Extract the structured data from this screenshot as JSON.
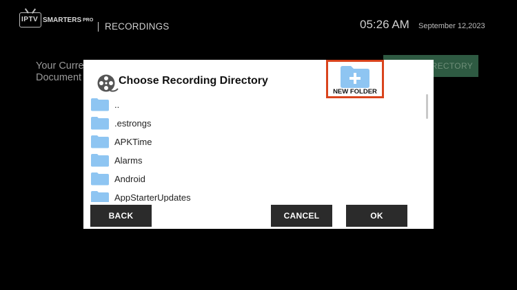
{
  "header": {
    "logo_tv_text": "IPTV",
    "logo_brand": "SMARTERS",
    "logo_pro": "PRO",
    "page_title": "RECORDINGS",
    "clock": "05:26 AM",
    "date": "September 12,2023"
  },
  "background": {
    "label_line1": "Your Curre",
    "label_line2": "Document",
    "button_partial": "RECTORY"
  },
  "dialog": {
    "title": "Choose Recording Directory",
    "new_folder_label": "NEW FOLDER",
    "items": [
      {
        "name": ".."
      },
      {
        "name": ".estrongs"
      },
      {
        "name": "APKTime"
      },
      {
        "name": "Alarms"
      },
      {
        "name": "Android"
      },
      {
        "name": "AppStarterUpdates"
      }
    ],
    "buttons": {
      "back": "BACK",
      "cancel": "CANCEL",
      "ok": "OK"
    }
  },
  "colors": {
    "background": "#000000",
    "dialog": "#ffffff",
    "folder": "#8ec5f2",
    "highlight_border": "#d9431c",
    "button": "#2b2b2b",
    "bg_button": "#2e5a42"
  },
  "icons": {
    "dialog_title": "film-reel-icon",
    "new_folder": "folder-plus-icon",
    "list_item": "folder-icon"
  }
}
